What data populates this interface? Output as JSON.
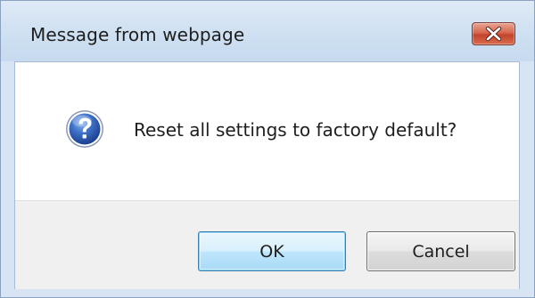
{
  "dialog": {
    "title": "Message from webpage",
    "message": "Reset all settings to factory default?",
    "icon": "question-icon",
    "close_icon": "close-icon",
    "buttons": {
      "ok_label": "OK",
      "cancel_label": "Cancel"
    }
  },
  "colors": {
    "titlebar": "#cddff1",
    "close_button": "#c4432d",
    "footer": "#f0f0f0",
    "ok_border": "#3c7fb1",
    "icon_blue": "#2f5fb0"
  }
}
